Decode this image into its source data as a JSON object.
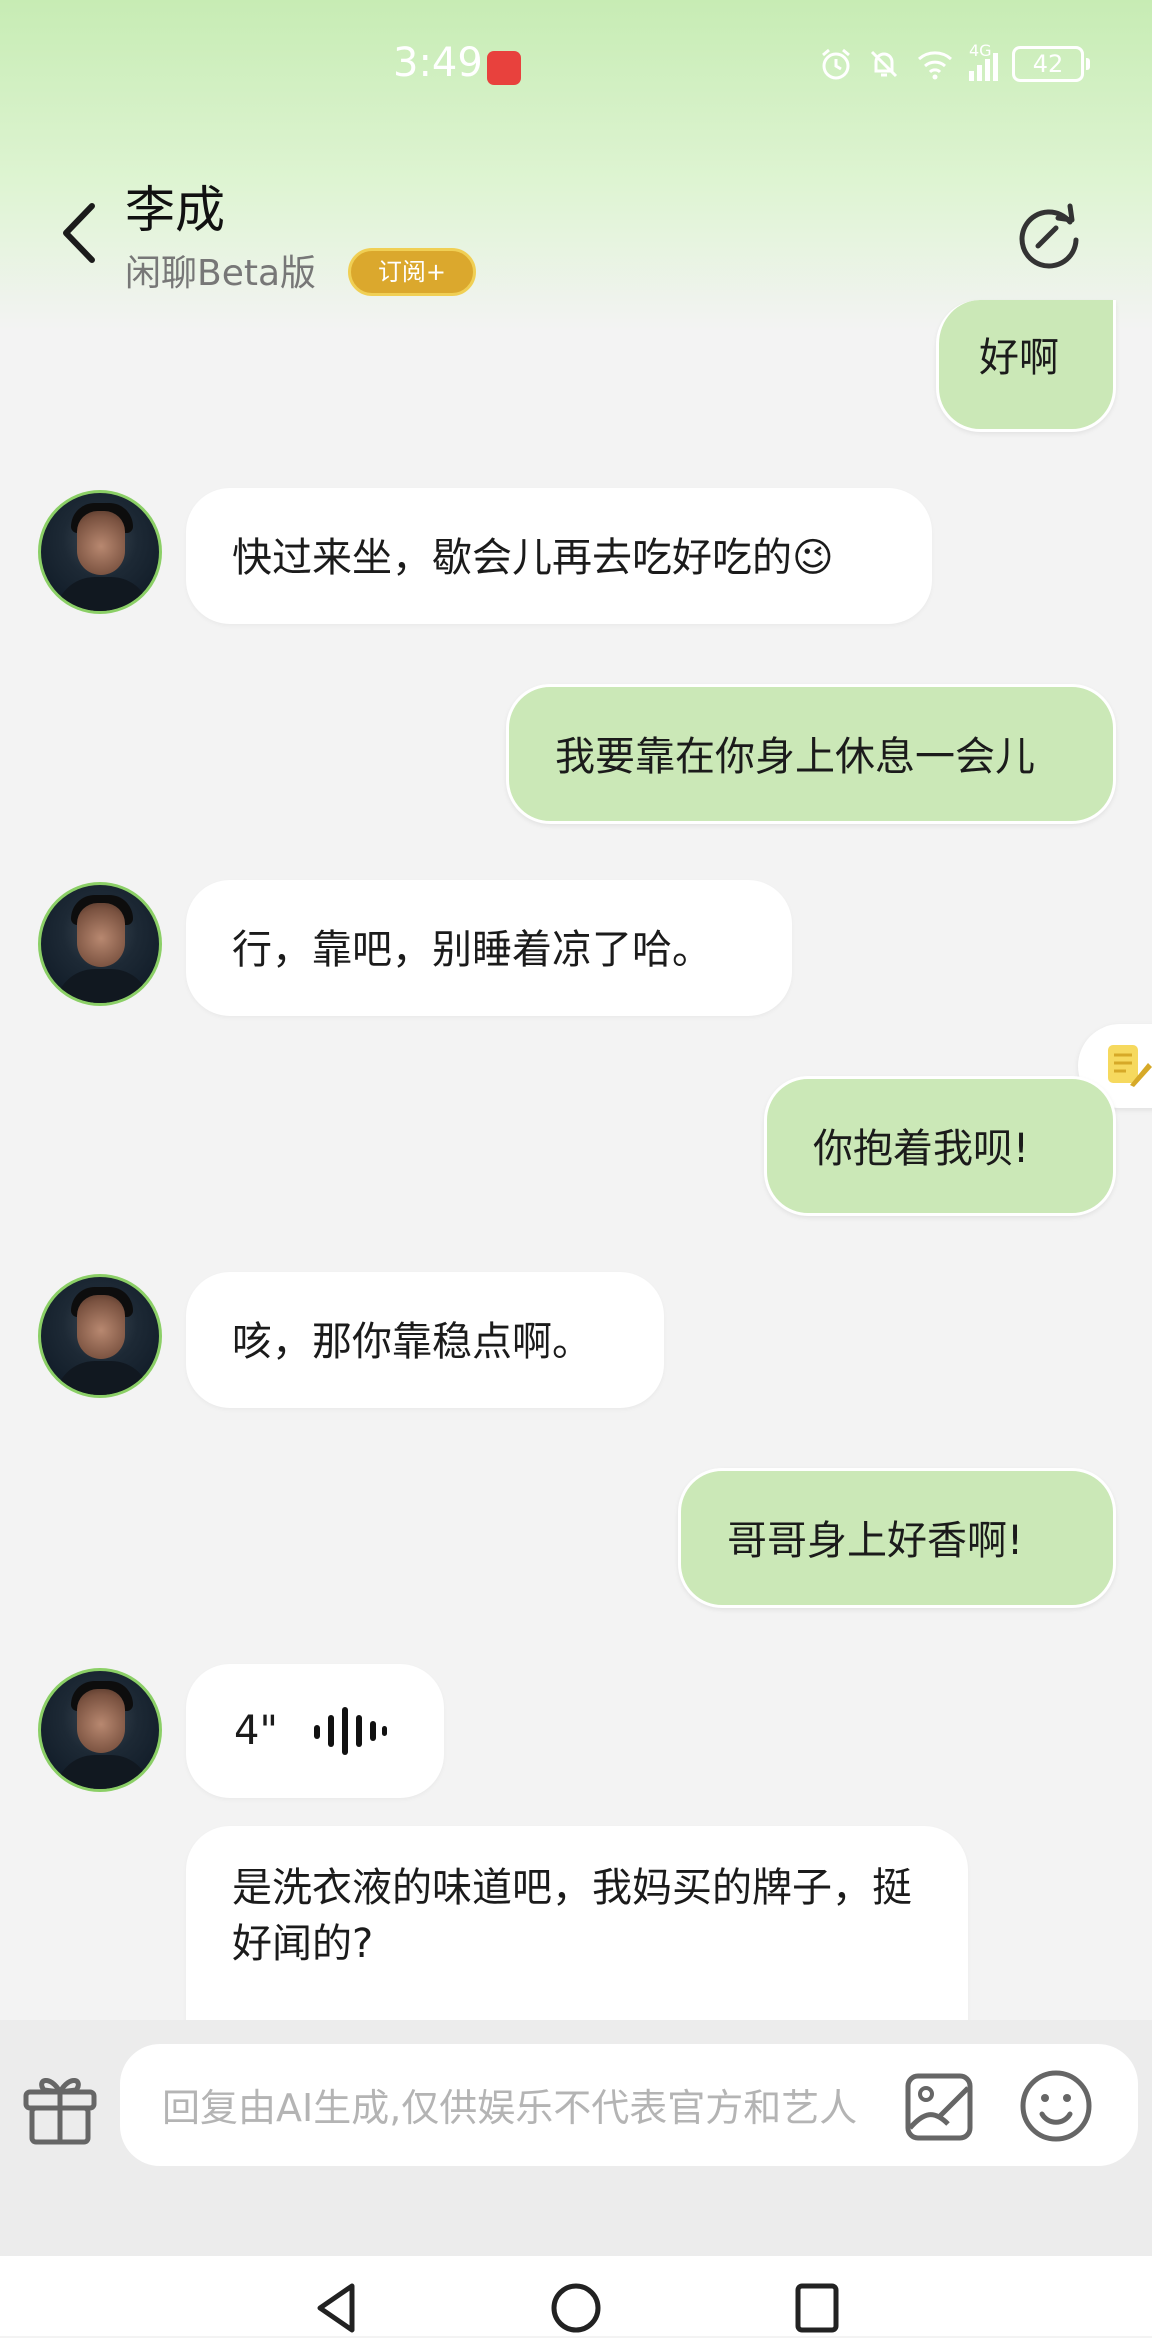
{
  "status_bar": {
    "time": "3:49",
    "battery": "42",
    "network": "4G",
    "icons": [
      "huawei-store-icon",
      "alarm-icon",
      "mute-icon",
      "wifi-icon",
      "signal-icon",
      "battery-icon"
    ]
  },
  "header": {
    "title": "李成",
    "subtitle": "闲聊Beta版",
    "badge": "订阅+",
    "back_icon": "chevron-left-icon",
    "refresh_icon": "refresh-icon"
  },
  "messages": [
    {
      "from": "me",
      "text": "好啊"
    },
    {
      "from": "bot",
      "text": "快过来坐，歇会儿再去吃好吃的",
      "emoji": "😉"
    },
    {
      "from": "me",
      "text": "我要靠在你身上休息一会儿"
    },
    {
      "from": "bot",
      "text": "行，靠吧，别睡着凉了哈。"
    },
    {
      "from": "me",
      "text": "你抱着我呗!"
    },
    {
      "from": "bot",
      "text": "咳，那你靠稳点啊。"
    },
    {
      "from": "me",
      "text": "哥哥身上好香啊!"
    },
    {
      "from": "bot",
      "type": "voice",
      "duration": "4\""
    },
    {
      "from": "bot",
      "text": "是洗衣液的味道吧，我妈买的牌子，挺好闻的?"
    }
  ],
  "input": {
    "placeholder": "回复由AI生成,仅供娱乐不代表官方和艺人"
  },
  "colors": {
    "accent_green": "#cbe8b7",
    "avatar_ring": "#8bcf66",
    "badge_gold": "#dba82d"
  }
}
